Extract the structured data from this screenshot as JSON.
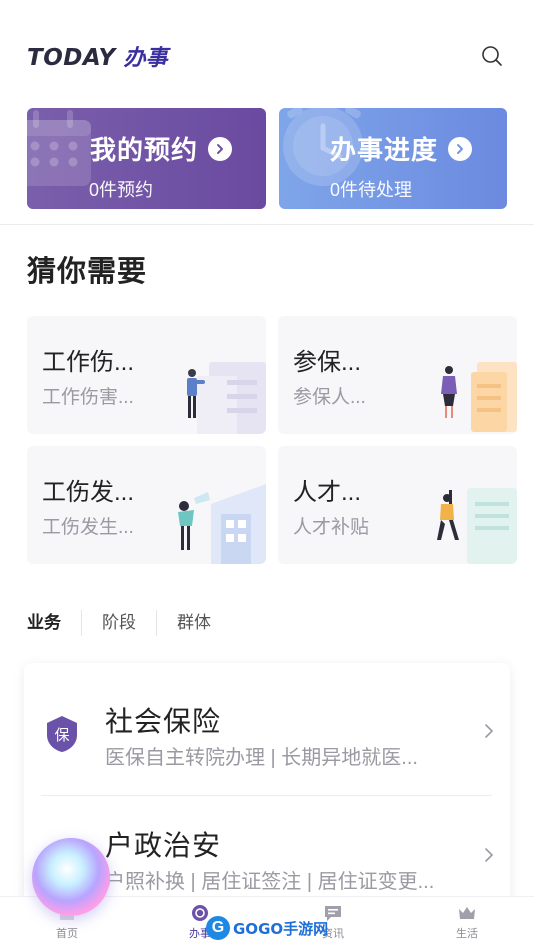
{
  "header": {
    "logo_today": "TODAY",
    "logo_banshi": "办事",
    "search_icon": "search-icon"
  },
  "top_cards": [
    {
      "title": "我的预约",
      "subtitle": "0件预约",
      "icon": "calendar-icon",
      "color": "#6f52a5"
    },
    {
      "title": "办事进度",
      "subtitle": "0件待处理",
      "icon": "clock-icon",
      "color": "#7597e6"
    }
  ],
  "recommend": {
    "title": "猜你需要",
    "items": [
      {
        "title": "工作伤...",
        "subtitle": "工作伤害..."
      },
      {
        "title": "参保...",
        "subtitle": "参保人..."
      },
      {
        "title": "工伤发...",
        "subtitle": "工伤发生..."
      },
      {
        "title": "人才...",
        "subtitle": "人才补贴"
      }
    ]
  },
  "tabs": [
    {
      "label": "业务",
      "active": true
    },
    {
      "label": "阶段",
      "active": false
    },
    {
      "label": "群体",
      "active": false
    }
  ],
  "services": [
    {
      "title": "社会保险",
      "subtitle": "医保自主转院办理 | 长期异地就医...",
      "badge": "保"
    },
    {
      "title": "户政治安",
      "subtitle": "户照补换 | 居住证签注 | 居住证变更..."
    }
  ],
  "bottom_nav": [
    {
      "label": "首页",
      "icon": "home-icon"
    },
    {
      "label": "办事",
      "icon": "service-icon",
      "active": true
    },
    {
      "label": "资讯",
      "icon": "message-icon"
    },
    {
      "label": "生活",
      "icon": "crown-icon"
    }
  ],
  "watermark": {
    "letter": "G",
    "text": "GOGO手游网"
  },
  "colors": {
    "accent": "#4a3aa0",
    "purple_card": "#6f52a5",
    "blue_card": "#7597e6"
  }
}
